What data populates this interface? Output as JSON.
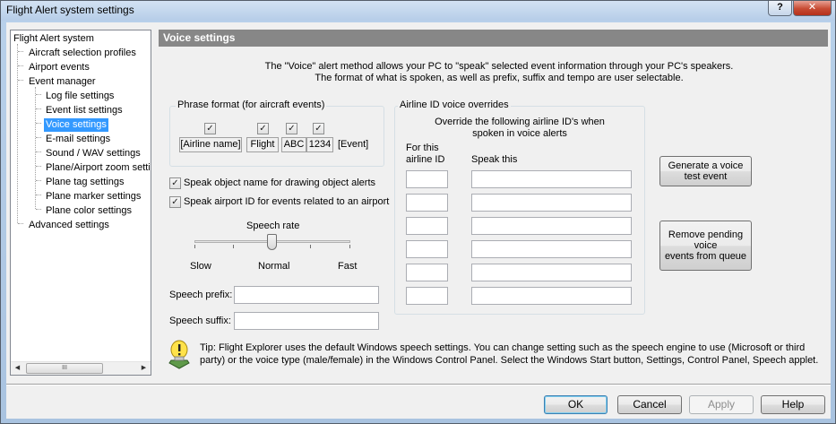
{
  "window": {
    "title": "Flight Alert system settings",
    "help_label": "?",
    "close_label": "✕"
  },
  "tree": {
    "items": [
      {
        "label": "Flight Alert system"
      },
      {
        "label": "Aircraft selection profiles"
      },
      {
        "label": "Airport events"
      },
      {
        "label": "Event manager"
      },
      {
        "label": "Log file settings"
      },
      {
        "label": "Event list settings"
      },
      {
        "label": "Voice settings"
      },
      {
        "label": "E-mail settings"
      },
      {
        "label": "Sound / WAV settings"
      },
      {
        "label": "Plane/Airport zoom setti"
      },
      {
        "label": "Plane tag settings"
      },
      {
        "label": "Plane marker settings"
      },
      {
        "label": "Plane color settings"
      },
      {
        "label": "Advanced settings"
      }
    ],
    "scroll_left": "◀",
    "scroll_right": "▶",
    "scroll_thumb_grip": "III"
  },
  "header": {
    "title": "Voice settings"
  },
  "intro": {
    "line1": "The \"Voice\" alert method allows your PC to \"speak\" selected event information through your PC's speakers.",
    "line2": "The format of what is spoken, as well as prefix, suffix and tempo are user selectable."
  },
  "phrase_format": {
    "label": "Phrase format (for aircraft events)",
    "fields": [
      {
        "label": "[Airline name]",
        "checked": true
      },
      {
        "label": "Flight",
        "checked": true
      },
      {
        "label": "ABC",
        "checked": true
      },
      {
        "label": "1234",
        "checked": true
      }
    ],
    "event_label": "[Event]",
    "check_glyph": "✓"
  },
  "options": {
    "speak_object_name": {
      "label": "Speak object name for drawing object alerts",
      "checked": true
    },
    "speak_airport_id": {
      "label": "Speak airport ID for events related to an airport",
      "checked": true
    }
  },
  "speech_rate": {
    "label": "Speech rate",
    "slow": "Slow",
    "normal": "Normal",
    "fast": "Fast",
    "value": 0.5
  },
  "speech_prefix": {
    "label": "Speech prefix:",
    "value": ""
  },
  "speech_suffix": {
    "label": "Speech suffix:",
    "value": ""
  },
  "airline_overrides": {
    "label": "Airline ID voice overrides",
    "description_line1": "Override the following airline ID's when",
    "description_line2": "spoken in voice alerts",
    "col_id_line1": "For this",
    "col_id_line2": "airline ID",
    "col_speak": "Speak this",
    "rows": [
      {
        "airline_id": "",
        "speak": ""
      },
      {
        "airline_id": "",
        "speak": ""
      },
      {
        "airline_id": "",
        "speak": ""
      },
      {
        "airline_id": "",
        "speak": ""
      },
      {
        "airline_id": "",
        "speak": ""
      },
      {
        "airline_id": "",
        "speak": ""
      }
    ]
  },
  "side_buttons": {
    "generate_line1": "Generate a voice",
    "generate_line2": "test event",
    "remove_line1": "Remove pending",
    "remove_line2": "voice",
    "remove_line3": "events from queue"
  },
  "tip": {
    "line1": "Tip: Flight Explorer uses the default Windows speech settings.  You can change setting such as the speech engine to use (Microsoft or third",
    "line2": "party) or the voice type (male/female) in the Windows Control Panel.  Select the Windows Start button, Settings, Control Panel, Speech applet."
  },
  "footer": {
    "ok": "OK",
    "cancel": "Cancel",
    "apply": "Apply",
    "help": "Help"
  }
}
